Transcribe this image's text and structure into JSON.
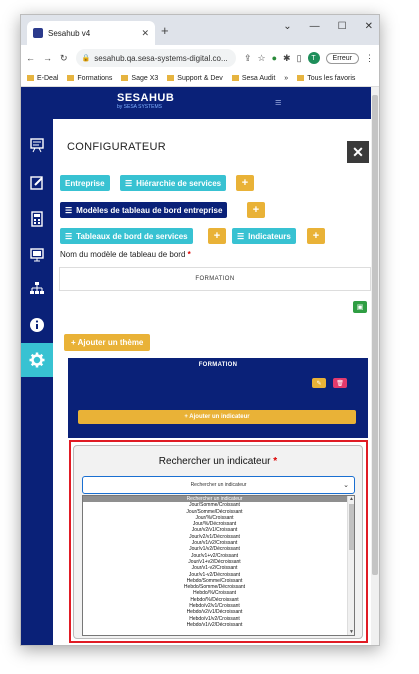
{
  "browser": {
    "tab_title": "Sesahub v4",
    "url": "sesahub.qa.sesa-systems-digital.co...",
    "error_button": "Erreur",
    "profile_initial": "T",
    "bookmarks": [
      "E-Deal",
      "Formations",
      "Sage X3",
      "Support & Dev",
      "Sesa Audit",
      "»",
      "Tous les favoris"
    ]
  },
  "app": {
    "logo": "SESAHUB",
    "logo_sub": "by SESA SYSTEMS"
  },
  "sidebar": {
    "items": [
      "board-icon",
      "edit-report-icon",
      "calculator-icon",
      "monitor-icon",
      "hierarchy-icon",
      "info-icon",
      "settings-icon"
    ],
    "active": "settings-icon"
  },
  "main": {
    "title": "CONFIGURATEUR",
    "buttons": {
      "entreprise": "Entreprise",
      "hierarchie": "Hiérarchie de services",
      "modeles": "Modèles de tableau de bord entreprise",
      "tableaux": "Tableaux de bord de services",
      "indicateurs": "Indicateurs",
      "plus": "+"
    },
    "field_label": "Nom du modèle de tableau de bord",
    "field_required": "*",
    "field_value": "FORMATION",
    "add_theme": "+ Ajouter un thème",
    "card_title": "FORMATION",
    "add_indicator": "+ Ajouter un indicateur"
  },
  "modal": {
    "title": "Rechercher un indicateur",
    "required": "*",
    "select_value": "Rechercher un indicateur",
    "options": [
      "Rechercher un indicateur",
      "Jour/Somme/Croissant",
      "Jour/Somme/Décroissant",
      "Jour/%/Croissant",
      "Jour/%/Décroissant",
      "Jour/v2/v1/Croissant",
      "Jour/v2/v1/Décroissant",
      "Jour/v1/v2/Croissant",
      "Jour/v1/v2/Décroissant",
      "Jour/v1+v2/Croissant",
      "Jour/v1+v2/Décroissant",
      "Jour/v1-v2/Croissant",
      "Jour/v1-v2/Décroissant",
      "Hebdo/Somme/Croissant",
      "Hebdo/Somme/Décroissant",
      "Hebdo/%/Croissant",
      "Hebdo/%/Décroissant",
      "Hebdo/v2/v1/Croissant",
      "Hebdo/v2/v1/Décroissant",
      "Hebdo/v1/v2/Croissant",
      "Hebdo/v1/v2/Décroissant"
    ]
  },
  "colors": {
    "navy": "#0a2178",
    "cyan": "#38c2d2",
    "amber": "#e9b237",
    "highlight": "#e01b24"
  }
}
